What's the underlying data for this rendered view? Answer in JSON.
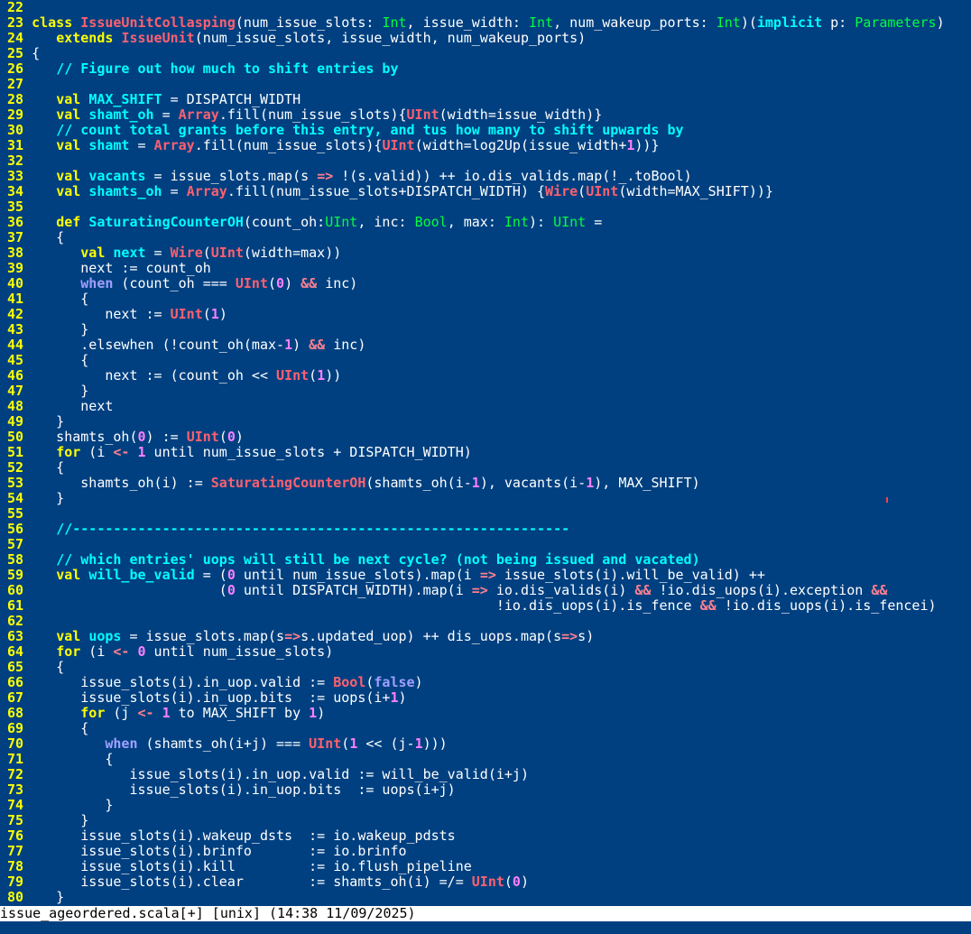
{
  "colors": {
    "background": "#004080",
    "line_number": "#ffff00",
    "keyword": "#ffff00",
    "type": "#00ff40",
    "call": "#ff6070",
    "name": "#00ffff",
    "comment": "#00ffff",
    "number": "#ff80ff",
    "status_bg": "#ffffff"
  },
  "editor": {
    "lines": [
      {
        "n": "22",
        "tokens": []
      },
      {
        "n": "23",
        "tokens": [
          [
            "kw",
            "class "
          ],
          [
            "call",
            "IssueUnitCollasping"
          ],
          [
            "plain",
            "(num_issue_slots: "
          ],
          [
            "type",
            "Int"
          ],
          [
            "plain",
            ", issue_width: "
          ],
          [
            "type",
            "Int"
          ],
          [
            "plain",
            ", num_wakeup_ports: "
          ],
          [
            "type",
            "Int"
          ],
          [
            "plain",
            ")("
          ],
          [
            "name",
            "implicit"
          ],
          [
            "plain",
            " p: "
          ],
          [
            "type",
            "Parameters"
          ],
          [
            "plain",
            ")"
          ]
        ]
      },
      {
        "n": "24",
        "tokens": [
          [
            "plain",
            "   "
          ],
          [
            "kw",
            "extends "
          ],
          [
            "call",
            "IssueUnit"
          ],
          [
            "plain",
            "(num_issue_slots, issue_width, num_wakeup_ports)"
          ]
        ]
      },
      {
        "n": "25",
        "tokens": [
          [
            "plain",
            "{"
          ]
        ]
      },
      {
        "n": "26",
        "tokens": [
          [
            "plain",
            "   "
          ],
          [
            "cmt",
            "// Figure out how much to shift entries by"
          ]
        ]
      },
      {
        "n": "27",
        "tokens": []
      },
      {
        "n": "28",
        "tokens": [
          [
            "plain",
            "   "
          ],
          [
            "kw",
            "val "
          ],
          [
            "name",
            "MAX_SHIFT"
          ],
          [
            "plain",
            " = DISPATCH_WIDTH"
          ]
        ]
      },
      {
        "n": "29",
        "tokens": [
          [
            "plain",
            "   "
          ],
          [
            "kw",
            "val "
          ],
          [
            "name",
            "shamt_oh"
          ],
          [
            "plain",
            " = "
          ],
          [
            "call",
            "Array"
          ],
          [
            "plain",
            ".fill(num_issue_slots){"
          ],
          [
            "call",
            "UInt"
          ],
          [
            "plain",
            "(width=issue_width)}"
          ]
        ]
      },
      {
        "n": "30",
        "tokens": [
          [
            "plain",
            "   "
          ],
          [
            "cmt",
            "// count total grants before this entry, and tus how many to shift upwards by"
          ]
        ]
      },
      {
        "n": "31",
        "tokens": [
          [
            "plain",
            "   "
          ],
          [
            "kw",
            "val "
          ],
          [
            "name",
            "shamt"
          ],
          [
            "plain",
            " = "
          ],
          [
            "call",
            "Array"
          ],
          [
            "plain",
            ".fill(num_issue_slots){"
          ],
          [
            "call",
            "UInt"
          ],
          [
            "plain",
            "(width=log2Up(issue_width+"
          ],
          [
            "num",
            "1"
          ],
          [
            "plain",
            "))}"
          ]
        ]
      },
      {
        "n": "32",
        "tokens": []
      },
      {
        "n": "33",
        "tokens": [
          [
            "plain",
            "   "
          ],
          [
            "kw",
            "val "
          ],
          [
            "name",
            "vacants"
          ],
          [
            "plain",
            " = issue_slots.map(s "
          ],
          [
            "op",
            "=>"
          ],
          [
            "plain",
            " !(s.valid)) ++ io.dis_valids.map(!_.toBool)"
          ]
        ]
      },
      {
        "n": "34",
        "tokens": [
          [
            "plain",
            "   "
          ],
          [
            "kw",
            "val "
          ],
          [
            "name",
            "shamts_oh"
          ],
          [
            "plain",
            " = "
          ],
          [
            "call",
            "Array"
          ],
          [
            "plain",
            ".fill(num_issue_slots+DISPATCH_WIDTH) {"
          ],
          [
            "call",
            "Wire"
          ],
          [
            "plain",
            "("
          ],
          [
            "call",
            "UInt"
          ],
          [
            "plain",
            "(width=MAX_SHIFT))}"
          ]
        ]
      },
      {
        "n": "35",
        "tokens": []
      },
      {
        "n": "36",
        "tokens": [
          [
            "plain",
            "   "
          ],
          [
            "kw",
            "def "
          ],
          [
            "name",
            "SaturatingCounterOH"
          ],
          [
            "plain",
            "(count_oh:"
          ],
          [
            "type",
            "UInt"
          ],
          [
            "plain",
            ", inc: "
          ],
          [
            "type",
            "Bool"
          ],
          [
            "plain",
            ", max: "
          ],
          [
            "type",
            "Int"
          ],
          [
            "plain",
            "): "
          ],
          [
            "type",
            "UInt"
          ],
          [
            "plain",
            " ="
          ]
        ]
      },
      {
        "n": "37",
        "tokens": [
          [
            "plain",
            "   {"
          ]
        ]
      },
      {
        "n": "38",
        "tokens": [
          [
            "plain",
            "      "
          ],
          [
            "kw",
            "val "
          ],
          [
            "name",
            "next"
          ],
          [
            "plain",
            " = "
          ],
          [
            "call",
            "Wire"
          ],
          [
            "plain",
            "("
          ],
          [
            "call",
            "UInt"
          ],
          [
            "plain",
            "(width=max))"
          ]
        ]
      },
      {
        "n": "39",
        "tokens": [
          [
            "plain",
            "      next := count_oh"
          ]
        ]
      },
      {
        "n": "40",
        "tokens": [
          [
            "plain",
            "      "
          ],
          [
            "kw2",
            "when"
          ],
          [
            "plain",
            " (count_oh === "
          ],
          [
            "call",
            "UInt"
          ],
          [
            "plain",
            "("
          ],
          [
            "num",
            "0"
          ],
          [
            "plain",
            ") "
          ],
          [
            "op",
            "&&"
          ],
          [
            "plain",
            " inc)"
          ]
        ]
      },
      {
        "n": "41",
        "tokens": [
          [
            "plain",
            "      {"
          ]
        ]
      },
      {
        "n": "42",
        "tokens": [
          [
            "plain",
            "         next := "
          ],
          [
            "call",
            "UInt"
          ],
          [
            "plain",
            "("
          ],
          [
            "num",
            "1"
          ],
          [
            "plain",
            ")"
          ]
        ]
      },
      {
        "n": "43",
        "tokens": [
          [
            "plain",
            "      }"
          ]
        ]
      },
      {
        "n": "44",
        "tokens": [
          [
            "plain",
            "      .elsewhen (!count_oh(max-"
          ],
          [
            "num",
            "1"
          ],
          [
            "plain",
            ") "
          ],
          [
            "op",
            "&&"
          ],
          [
            "plain",
            " inc)"
          ]
        ]
      },
      {
        "n": "45",
        "tokens": [
          [
            "plain",
            "      {"
          ]
        ]
      },
      {
        "n": "46",
        "tokens": [
          [
            "plain",
            "         next := (count_oh << "
          ],
          [
            "call",
            "UInt"
          ],
          [
            "plain",
            "("
          ],
          [
            "num",
            "1"
          ],
          [
            "plain",
            "))"
          ]
        ]
      },
      {
        "n": "47",
        "tokens": [
          [
            "plain",
            "      }"
          ]
        ]
      },
      {
        "n": "48",
        "tokens": [
          [
            "plain",
            "      next"
          ]
        ]
      },
      {
        "n": "49",
        "tokens": [
          [
            "plain",
            "   }"
          ]
        ]
      },
      {
        "n": "50",
        "tokens": [
          [
            "plain",
            "   shamts_oh("
          ],
          [
            "num",
            "0"
          ],
          [
            "plain",
            ") := "
          ],
          [
            "call",
            "UInt"
          ],
          [
            "plain",
            "("
          ],
          [
            "num",
            "0"
          ],
          [
            "plain",
            ")"
          ]
        ]
      },
      {
        "n": "51",
        "tokens": [
          [
            "plain",
            "   "
          ],
          [
            "kw",
            "for"
          ],
          [
            "plain",
            " (i "
          ],
          [
            "op",
            "<-"
          ],
          [
            "plain",
            " "
          ],
          [
            "num",
            "1"
          ],
          [
            "plain",
            " until num_issue_slots + DISPATCH_WIDTH)"
          ]
        ]
      },
      {
        "n": "52",
        "tokens": [
          [
            "plain",
            "   {"
          ]
        ]
      },
      {
        "n": "53",
        "tokens": [
          [
            "plain",
            "      shamts_oh(i) := "
          ],
          [
            "call",
            "SaturatingCounterOH"
          ],
          [
            "plain",
            "(shamts_oh(i-"
          ],
          [
            "num",
            "1"
          ],
          [
            "plain",
            "), vacants(i-"
          ],
          [
            "num",
            "1"
          ],
          [
            "plain",
            "), MAX_SHIFT)"
          ]
        ]
      },
      {
        "n": "54",
        "tokens": [
          [
            "plain",
            "   }"
          ]
        ]
      },
      {
        "n": "55",
        "tokens": []
      },
      {
        "n": "56",
        "tokens": [
          [
            "plain",
            "   "
          ],
          [
            "cmt",
            "//-------------------------------------------------------------"
          ]
        ]
      },
      {
        "n": "57",
        "tokens": []
      },
      {
        "n": "58",
        "tokens": [
          [
            "plain",
            "   "
          ],
          [
            "cmt",
            "// which entries' uops will still be next cycle? (not being issued and vacated)"
          ]
        ]
      },
      {
        "n": "59",
        "tokens": [
          [
            "plain",
            "   "
          ],
          [
            "kw",
            "val "
          ],
          [
            "name",
            "will_be_valid"
          ],
          [
            "plain",
            " = ("
          ],
          [
            "num",
            "0"
          ],
          [
            "plain",
            " until num_issue_slots).map(i "
          ],
          [
            "op",
            "=>"
          ],
          [
            "plain",
            " issue_slots(i).will_be_valid) ++"
          ]
        ]
      },
      {
        "n": "60",
        "tokens": [
          [
            "plain",
            "                       ("
          ],
          [
            "num",
            "0"
          ],
          [
            "plain",
            " until DISPATCH_WIDTH).map(i "
          ],
          [
            "op",
            "=>"
          ],
          [
            "plain",
            " io.dis_valids(i) "
          ],
          [
            "op",
            "&&"
          ],
          [
            "plain",
            " !io.dis_uops(i).exception "
          ],
          [
            "op",
            "&&"
          ]
        ]
      },
      {
        "n": "61",
        "tokens": [
          [
            "plain",
            "                                                         !io.dis_uops(i).is_fence "
          ],
          [
            "op",
            "&&"
          ],
          [
            "plain",
            " !io.dis_uops(i).is_fencei)"
          ]
        ]
      },
      {
        "n": "62",
        "tokens": []
      },
      {
        "n": "63",
        "tokens": [
          [
            "plain",
            "   "
          ],
          [
            "kw",
            "val "
          ],
          [
            "name",
            "uops"
          ],
          [
            "plain",
            " = issue_slots.map(s"
          ],
          [
            "op",
            "=>"
          ],
          [
            "plain",
            "s.updated_uop) ++ dis_uops.map(s"
          ],
          [
            "op",
            "=>"
          ],
          [
            "plain",
            "s)"
          ]
        ]
      },
      {
        "n": "64",
        "tokens": [
          [
            "plain",
            "   "
          ],
          [
            "kw",
            "for"
          ],
          [
            "plain",
            " (i "
          ],
          [
            "op",
            "<-"
          ],
          [
            "plain",
            " "
          ],
          [
            "num",
            "0"
          ],
          [
            "plain",
            " until num_issue_slots)"
          ]
        ]
      },
      {
        "n": "65",
        "tokens": [
          [
            "plain",
            "   {"
          ]
        ]
      },
      {
        "n": "66",
        "tokens": [
          [
            "plain",
            "      issue_slots(i).in_uop.valid := "
          ],
          [
            "call",
            "Bool"
          ],
          [
            "plain",
            "("
          ],
          [
            "kw2",
            "false"
          ],
          [
            "plain",
            ")"
          ]
        ]
      },
      {
        "n": "67",
        "tokens": [
          [
            "plain",
            "      issue_slots(i).in_uop.bits  := uops(i+"
          ],
          [
            "num",
            "1"
          ],
          [
            "plain",
            ")"
          ]
        ]
      },
      {
        "n": "68",
        "tokens": [
          [
            "plain",
            "      "
          ],
          [
            "kw",
            "for"
          ],
          [
            "plain",
            " (j "
          ],
          [
            "op",
            "<-"
          ],
          [
            "plain",
            " "
          ],
          [
            "num",
            "1"
          ],
          [
            "plain",
            " to MAX_SHIFT by "
          ],
          [
            "num",
            "1"
          ],
          [
            "plain",
            ")"
          ]
        ]
      },
      {
        "n": "69",
        "tokens": [
          [
            "plain",
            "      {"
          ]
        ]
      },
      {
        "n": "70",
        "tokens": [
          [
            "plain",
            "         "
          ],
          [
            "kw2",
            "when"
          ],
          [
            "plain",
            " (shamts_oh(i+j) === "
          ],
          [
            "call",
            "UInt"
          ],
          [
            "plain",
            "("
          ],
          [
            "num",
            "1"
          ],
          [
            "plain",
            " << (j-"
          ],
          [
            "num",
            "1"
          ],
          [
            "plain",
            ")))"
          ]
        ]
      },
      {
        "n": "71",
        "tokens": [
          [
            "plain",
            "         {"
          ]
        ]
      },
      {
        "n": "72",
        "tokens": [
          [
            "plain",
            "            issue_slots(i).in_uop.valid := will_be_valid(i+j)"
          ]
        ]
      },
      {
        "n": "73",
        "tokens": [
          [
            "plain",
            "            issue_slots(i).in_uop.bits  := uops(i+j)"
          ]
        ]
      },
      {
        "n": "74",
        "tokens": [
          [
            "plain",
            "         }"
          ]
        ]
      },
      {
        "n": "75",
        "tokens": [
          [
            "plain",
            "      }"
          ]
        ]
      },
      {
        "n": "76",
        "tokens": [
          [
            "plain",
            "      issue_slots(i).wakeup_dsts  := io.wakeup_pdsts"
          ]
        ]
      },
      {
        "n": "77",
        "tokens": [
          [
            "plain",
            "      issue_slots(i).brinfo       := io.brinfo"
          ]
        ]
      },
      {
        "n": "78",
        "tokens": [
          [
            "plain",
            "      issue_slots(i).kill         := io.flush_pipeline"
          ]
        ]
      },
      {
        "n": "79",
        "tokens": [
          [
            "plain",
            "      issue_slots(i).clear        := shamts_oh(i) =/= "
          ],
          [
            "call",
            "UInt"
          ],
          [
            "plain",
            "("
          ],
          [
            "num",
            "0"
          ],
          [
            "plain",
            ")"
          ]
        ]
      },
      {
        "n": "80",
        "tokens": [
          [
            "plain",
            "   }"
          ]
        ]
      }
    ]
  },
  "status": {
    "text": "issue_ageordered.scala[+] [unix] (14:38 11/09/2025)"
  }
}
